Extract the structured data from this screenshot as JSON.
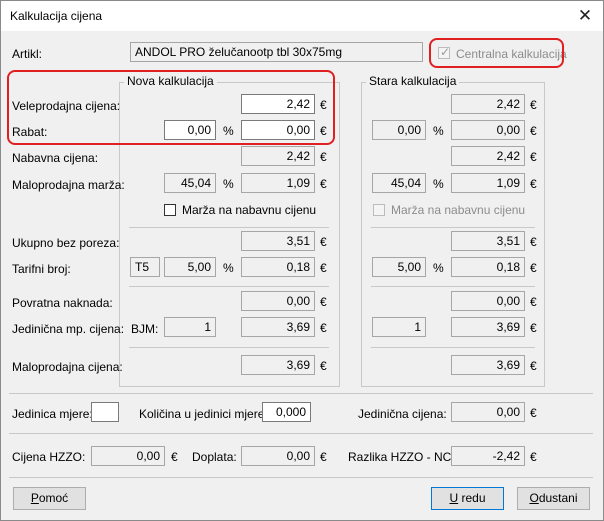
{
  "window": {
    "title": "Kalkulacija cijena"
  },
  "artikl": {
    "label": "Artikl:",
    "value": "ANDOL PRO želučanootp tbl 30x75mg"
  },
  "centralna": {
    "label": "Centralna kalkulacija",
    "checked": true
  },
  "groups": {
    "nova": "Nova kalkulacija",
    "stara": "Stara kalkulacija"
  },
  "labels": {
    "veleprodajna": "Veleprodajna cijena:",
    "rabat": "Rabat:",
    "nabavna": "Nabavna cijena:",
    "marza": "Maloprodajna marža:",
    "marza_chk": "Marža na nabavnu cijenu",
    "ukupno": "Ukupno bez poreza:",
    "tarifni": "Tarifni broj:",
    "povratna": "Povratna naknada:",
    "jedinicna_mp": "Jedinična mp. cijena:",
    "bjm": "BJM:",
    "maloprodajna": "Maloprodajna cijena:"
  },
  "units": {
    "euro": "€",
    "pct": "%"
  },
  "nova": {
    "veleprodajna": "2,42",
    "rabat_pct": "0,00",
    "rabat_val": "0,00",
    "nabavna": "2,42",
    "marza_pct": "45,04",
    "marza_val": "1,09",
    "ukupno": "3,51",
    "tarifni_code": "T5",
    "tarifni_pct": "5,00",
    "tarifni_val": "0,18",
    "povratna": "0,00",
    "bjm": "1",
    "jedinicna": "3,69",
    "maloprodajna": "3,69"
  },
  "stara": {
    "veleprodajna": "2,42",
    "rabat_pct": "0,00",
    "rabat_val": "0,00",
    "nabavna": "2,42",
    "marza_pct": "45,04",
    "marza_val": "1,09",
    "ukupno": "3,51",
    "tarifni_pct": "5,00",
    "tarifni_val": "0,18",
    "povratna": "0,00",
    "bjm": "1",
    "jedinicna": "3,69",
    "maloprodajna": "3,69"
  },
  "bottom": {
    "jedinica_label": "Jedinica mjere:",
    "jedinica_value": "",
    "kolicina_label": "Količina u jedinici mjere:",
    "kolicina_value": "0,000",
    "jed_cijena_label": "Jedinična cijena:",
    "jed_cijena_value": "0,00",
    "hzzo_label": "Cijena HZZO:",
    "hzzo_value": "0,00",
    "doplata_label": "Doplata:",
    "doplata_value": "0,00",
    "razlika_label": "Razlika HZZO - NC:",
    "razlika_value": "-2,42"
  },
  "buttons": {
    "pomoc_ul": "P",
    "pomoc_rest": "omoć",
    "ured_ul": "U",
    "ured_rest": " redu",
    "odustani_ul": "O",
    "odustani_rest": "dustani"
  }
}
